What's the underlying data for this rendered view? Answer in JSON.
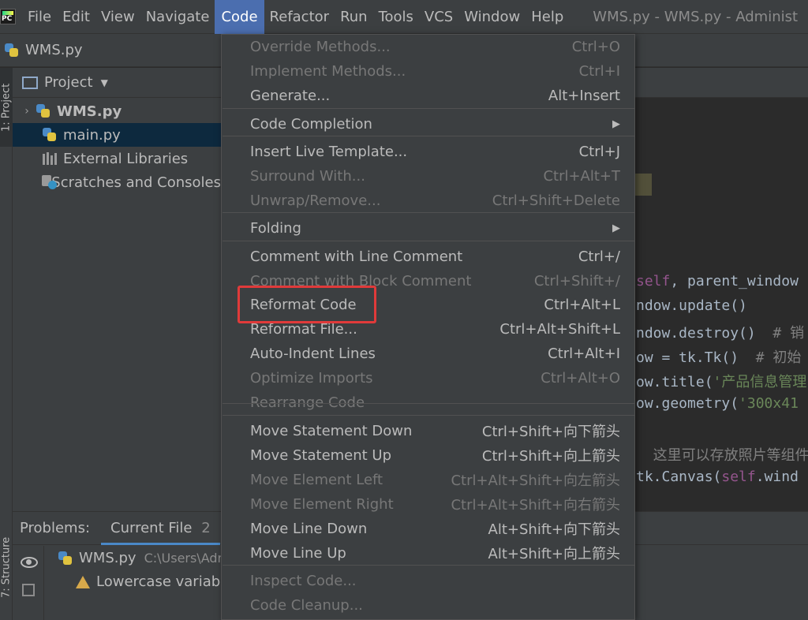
{
  "menubar": {
    "items": [
      "File",
      "Edit",
      "View",
      "Navigate",
      "Code",
      "Refactor",
      "Run",
      "Tools",
      "VCS",
      "Window",
      "Help"
    ],
    "active": "Code",
    "window_title": "WMS.py - WMS.py - Administ"
  },
  "navbar": {
    "file": "WMS.py"
  },
  "left_strip": {
    "project_tab": "1: Project",
    "structure_tab": "7: Structure"
  },
  "project": {
    "header": "Project",
    "tree": [
      {
        "label": "WMS.py",
        "type": "root"
      },
      {
        "label": "main.py",
        "type": "file",
        "selected": true
      },
      {
        "label": "External Libraries",
        "type": "libraries"
      },
      {
        "label": "Scratches and Consoles",
        "type": "scratches"
      }
    ]
  },
  "code_menu": {
    "items": [
      {
        "label": "Override Methods...",
        "shortcut": "Ctrl+O",
        "enabled": false
      },
      {
        "label": "Implement Methods...",
        "shortcut": "Ctrl+I",
        "enabled": false
      },
      {
        "label": "Generate...",
        "shortcut": "Alt+Insert",
        "enabled": true
      },
      {
        "label": "Code Completion",
        "shortcut": "",
        "enabled": true,
        "submenu": true
      },
      {
        "label": "Insert Live Template...",
        "shortcut": "Ctrl+J",
        "enabled": true
      },
      {
        "label": "Surround With...",
        "shortcut": "Ctrl+Alt+T",
        "enabled": false
      },
      {
        "label": "Unwrap/Remove...",
        "shortcut": "Ctrl+Shift+Delete",
        "enabled": false
      },
      {
        "label": "Folding",
        "shortcut": "",
        "enabled": true,
        "submenu": true
      },
      {
        "label": "Comment with Line Comment",
        "shortcut": "Ctrl+/",
        "enabled": true
      },
      {
        "label": "Comment with Block Comment",
        "shortcut": "Ctrl+Shift+/",
        "enabled": false
      },
      {
        "label": "Reformat Code",
        "shortcut": "Ctrl+Alt+L",
        "enabled": true,
        "highlighted": true
      },
      {
        "label": "Reformat File...",
        "shortcut": "Ctrl+Alt+Shift+L",
        "enabled": true
      },
      {
        "label": "Auto-Indent Lines",
        "shortcut": "Ctrl+Alt+I",
        "enabled": true
      },
      {
        "label": "Optimize Imports",
        "shortcut": "Ctrl+Alt+O",
        "enabled": false
      },
      {
        "label": "Rearrange Code",
        "shortcut": "",
        "enabled": false
      },
      {
        "label": "Move Statement Down",
        "shortcut": "Ctrl+Shift+向下箭头",
        "enabled": true
      },
      {
        "label": "Move Statement Up",
        "shortcut": "Ctrl+Shift+向上箭头",
        "enabled": true
      },
      {
        "label": "Move Element Left",
        "shortcut": "Ctrl+Alt+Shift+向左箭头",
        "enabled": false
      },
      {
        "label": "Move Element Right",
        "shortcut": "Ctrl+Alt+Shift+向右箭头",
        "enabled": false
      },
      {
        "label": "Move Line Down",
        "shortcut": "Alt+Shift+向下箭头",
        "enabled": true
      },
      {
        "label": "Move Line Up",
        "shortcut": "Alt+Shift+向上箭头",
        "enabled": true
      },
      {
        "label": "Inspect Code...",
        "shortcut": "",
        "enabled": false
      },
      {
        "label": "Code Cleanup...",
        "shortcut": "",
        "enabled": false
      }
    ],
    "highlight_color": "#e03a3a"
  },
  "editor": {
    "lines": [
      {
        "parts": [
          {
            "t": "self",
            "c": "kw"
          },
          {
            "t": ", parent_window",
            "c": ""
          }
        ]
      },
      {
        "parts": [
          {
            "t": "ndow.update()",
            "c": ""
          }
        ]
      },
      {
        "parts": [
          {
            "t": "ndow.destroy()  ",
            "c": ""
          },
          {
            "t": "# 销",
            "c": "cm"
          }
        ]
      },
      {
        "parts": [
          {
            "t": "ow = tk.Tk()  ",
            "c": ""
          },
          {
            "t": "# 初始",
            "c": "cm"
          }
        ]
      },
      {
        "parts": [
          {
            "t": "ow.title(",
            "c": ""
          },
          {
            "t": "'产品信息管理",
            "c": "str"
          }
        ]
      },
      {
        "parts": [
          {
            "t": "ow.geometry(",
            "c": ""
          },
          {
            "t": "'300x41",
            "c": "str"
          }
        ]
      },
      {
        "parts": [
          {
            "t": "",
            "c": ""
          }
        ]
      },
      {
        "parts": [
          {
            "t": "  这里可以存放照片等组件",
            "c": "cm"
          }
        ]
      },
      {
        "parts": [
          {
            "t": "tk.Canvas(",
            "c": ""
          },
          {
            "t": "self",
            "c": "kw"
          },
          {
            "t": ".wind",
            "c": ""
          }
        ]
      }
    ]
  },
  "problems": {
    "label": "Problems:",
    "tab": "Current File",
    "count": "2",
    "file": "WMS.py",
    "path": "C:\\Users\\Adr",
    "warning": "Lowercase variable"
  }
}
